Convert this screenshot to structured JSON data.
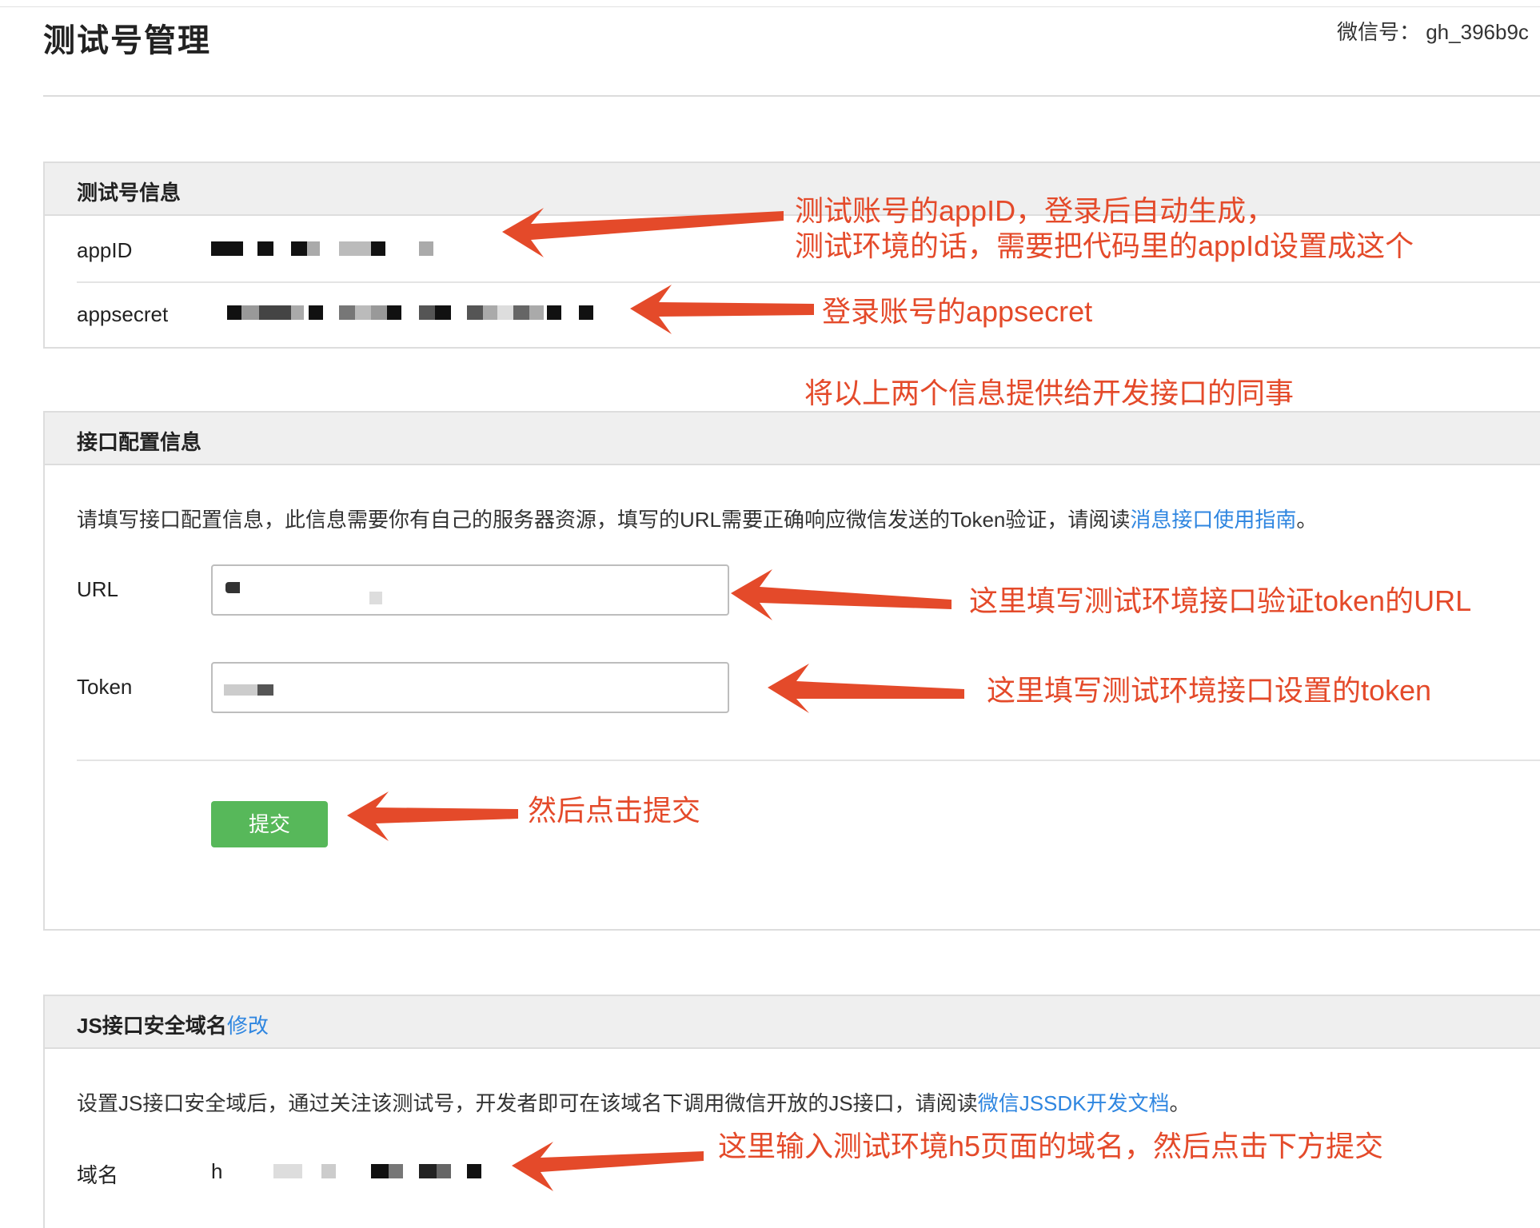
{
  "header": {
    "page_title": "测试号管理",
    "wechat_id": "微信号： gh_396b9c"
  },
  "test_account_panel": {
    "title": "测试号信息",
    "appid_label": "appID",
    "appsecret_label": "appsecret"
  },
  "interface_panel": {
    "title": "接口配置信息",
    "description": "请填写接口配置信息，此信息需要你有自己的服务器资源，填写的URL需要正确响应微信发送的Token验证，请阅读",
    "guide_link": "消息接口使用指南",
    "description_end": "。",
    "url_label": "URL",
    "token_label": "Token",
    "submit_label": "提交"
  },
  "js_domain_panel": {
    "title": "JS接口安全域名",
    "edit_link": "修改",
    "description": "设置JS接口安全域后，通过关注该测试号，开发者即可在该域名下调用微信开放的JS接口，请阅读",
    "doc_link": "微信JSSDK开发文档",
    "description_end": "。",
    "domain_label": "域名",
    "domain_value_prefix": "h"
  },
  "annotations": {
    "appid_note_line1": "测试账号的appID，登录后自动生成，",
    "appid_note_line2": "测试环境的话，需要把代码里的appId设置成这个",
    "appsecret_note": "登录账号的appsecret",
    "share_note": "将以上两个信息提供给开发接口的同事",
    "url_note": "这里填写测试环境接口验证token的URL",
    "token_note": "这里填写测试环境接口设置的token",
    "submit_note": "然后点击提交",
    "domain_note": "这里输入测试环境h5页面的域名，然后点击下方提交"
  },
  "colors": {
    "annotation": "#e44a2a",
    "link": "#2f86e0",
    "submit_button": "#57b85a",
    "panel_header": "#efefef"
  }
}
